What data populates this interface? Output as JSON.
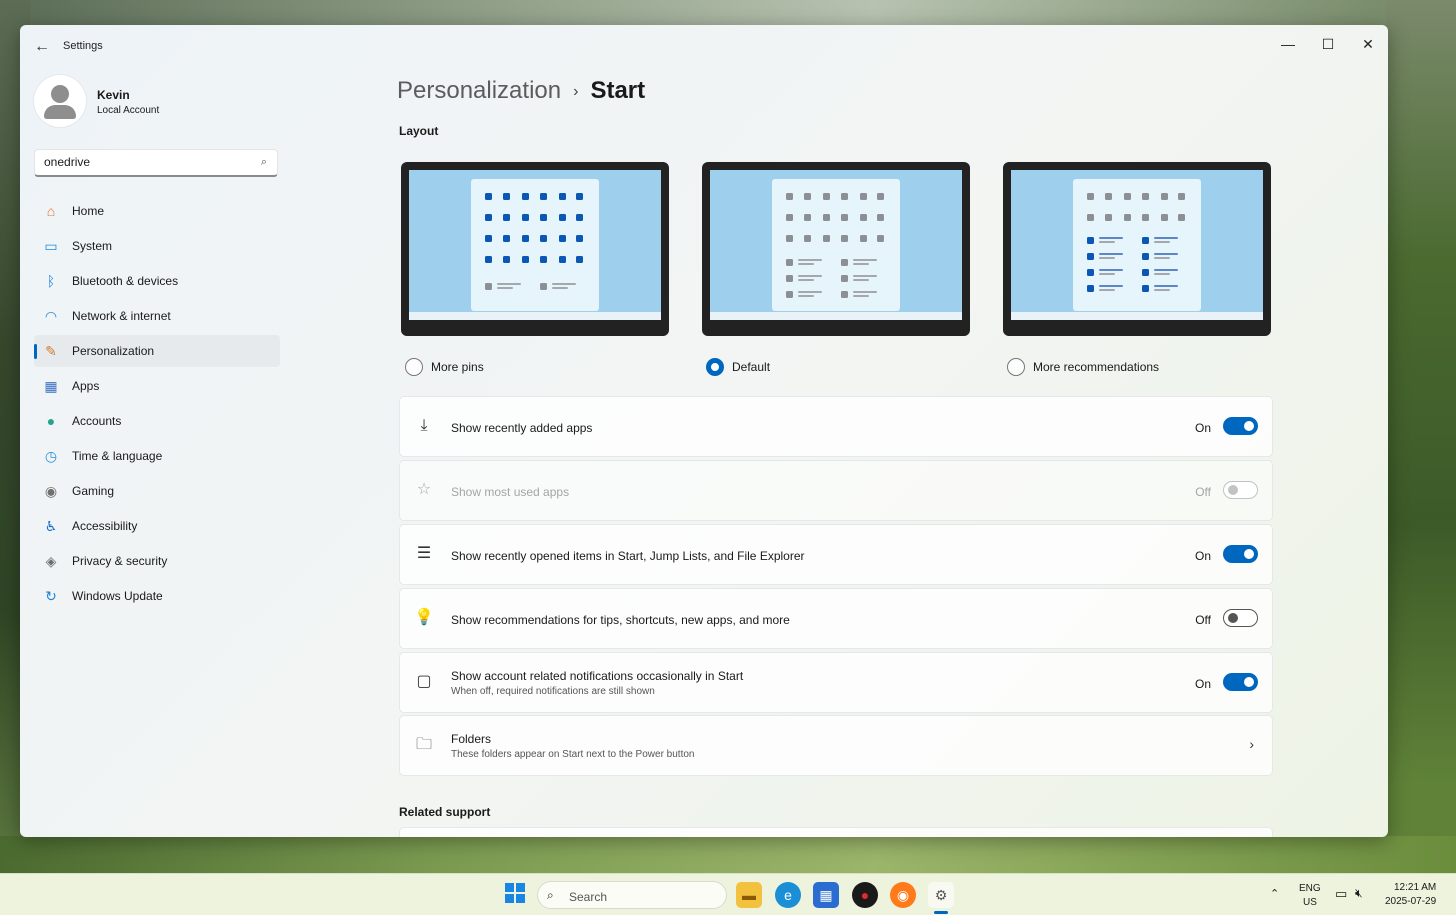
{
  "window": {
    "title": "Settings",
    "controls": {
      "minimize": "—",
      "maximize": "☐",
      "close": "✕"
    }
  },
  "profile": {
    "name": "Kevin",
    "subtitle": "Local Account"
  },
  "search": {
    "value": "onedrive"
  },
  "sidebar": {
    "items": [
      {
        "label": "Home",
        "icon": "home-icon",
        "glyph": "⌂",
        "color": "#e8742c"
      },
      {
        "label": "System",
        "icon": "system-icon",
        "glyph": "▭",
        "color": "#1e8ad6"
      },
      {
        "label": "Bluetooth & devices",
        "icon": "bluetooth-icon",
        "glyph": "ᛒ",
        "color": "#1e7fd9"
      },
      {
        "label": "Network & internet",
        "icon": "wifi-icon",
        "glyph": "◠",
        "color": "#2584d6"
      },
      {
        "label": "Personalization",
        "icon": "brush-icon",
        "glyph": "✎",
        "color": "#d27a2a",
        "selected": true
      },
      {
        "label": "Apps",
        "icon": "apps-icon",
        "glyph": "▦",
        "color": "#3a6fc4"
      },
      {
        "label": "Accounts",
        "icon": "accounts-icon",
        "glyph": "●",
        "color": "#2aa38c"
      },
      {
        "label": "Time & language",
        "icon": "globe-clock-icon",
        "glyph": "◷",
        "color": "#2b8fd6"
      },
      {
        "label": "Gaming",
        "icon": "controller-icon",
        "glyph": "◉",
        "color": "#707070"
      },
      {
        "label": "Accessibility",
        "icon": "accessibility-icon",
        "glyph": "♿",
        "color": "#1a6fd0"
      },
      {
        "label": "Privacy & security",
        "icon": "shield-icon",
        "glyph": "◈",
        "color": "#6c6f74"
      },
      {
        "label": "Windows Update",
        "icon": "update-icon",
        "glyph": "↻",
        "color": "#1a84d8"
      }
    ]
  },
  "breadcrumb": {
    "parent": "Personalization",
    "separator": "›",
    "current": "Start"
  },
  "layout": {
    "title": "Layout",
    "options": [
      {
        "label": "More pins",
        "checked": false
      },
      {
        "label": "Default",
        "checked": true
      },
      {
        "label": "More recommendations",
        "checked": false
      }
    ]
  },
  "settings": [
    {
      "title": "Show recently added apps",
      "subtitle": "",
      "state": "On",
      "on": true,
      "disabled": false,
      "icon": "download-icon",
      "glyph": "⤓"
    },
    {
      "title": "Show most used apps",
      "subtitle": "",
      "state": "Off",
      "on": false,
      "disabled": true,
      "icon": "star-icon",
      "glyph": "☆"
    },
    {
      "title": "Show recently opened items in Start, Jump Lists, and File Explorer",
      "subtitle": "",
      "state": "On",
      "on": true,
      "disabled": false,
      "icon": "list-icon",
      "glyph": "☰"
    },
    {
      "title": "Show recommendations for tips, shortcuts, new apps, and more",
      "subtitle": "",
      "state": "Off",
      "on": false,
      "disabled": false,
      "icon": "lightbulb-icon",
      "glyph": "💡"
    },
    {
      "title": "Show account related notifications occasionally in Start",
      "subtitle": "When off, required notifications are still shown",
      "state": "On",
      "on": true,
      "disabled": false,
      "icon": "notification-icon",
      "glyph": "▢"
    },
    {
      "title": "Folders",
      "subtitle": "These folders appear on Start next to the Power button",
      "state": "",
      "on": null,
      "disabled": false,
      "icon": "folder-icon",
      "glyph": "🗀",
      "chevron": "›"
    }
  ],
  "related": {
    "title": "Related support"
  },
  "taskbar": {
    "search_label": "Search",
    "lang_top": "ENG",
    "lang_bottom": "US",
    "time": "12:21 AM",
    "date": "2025-07-29",
    "tray_up": "⌃",
    "tray_net": "▭",
    "tray_sound": "🔇︎"
  }
}
